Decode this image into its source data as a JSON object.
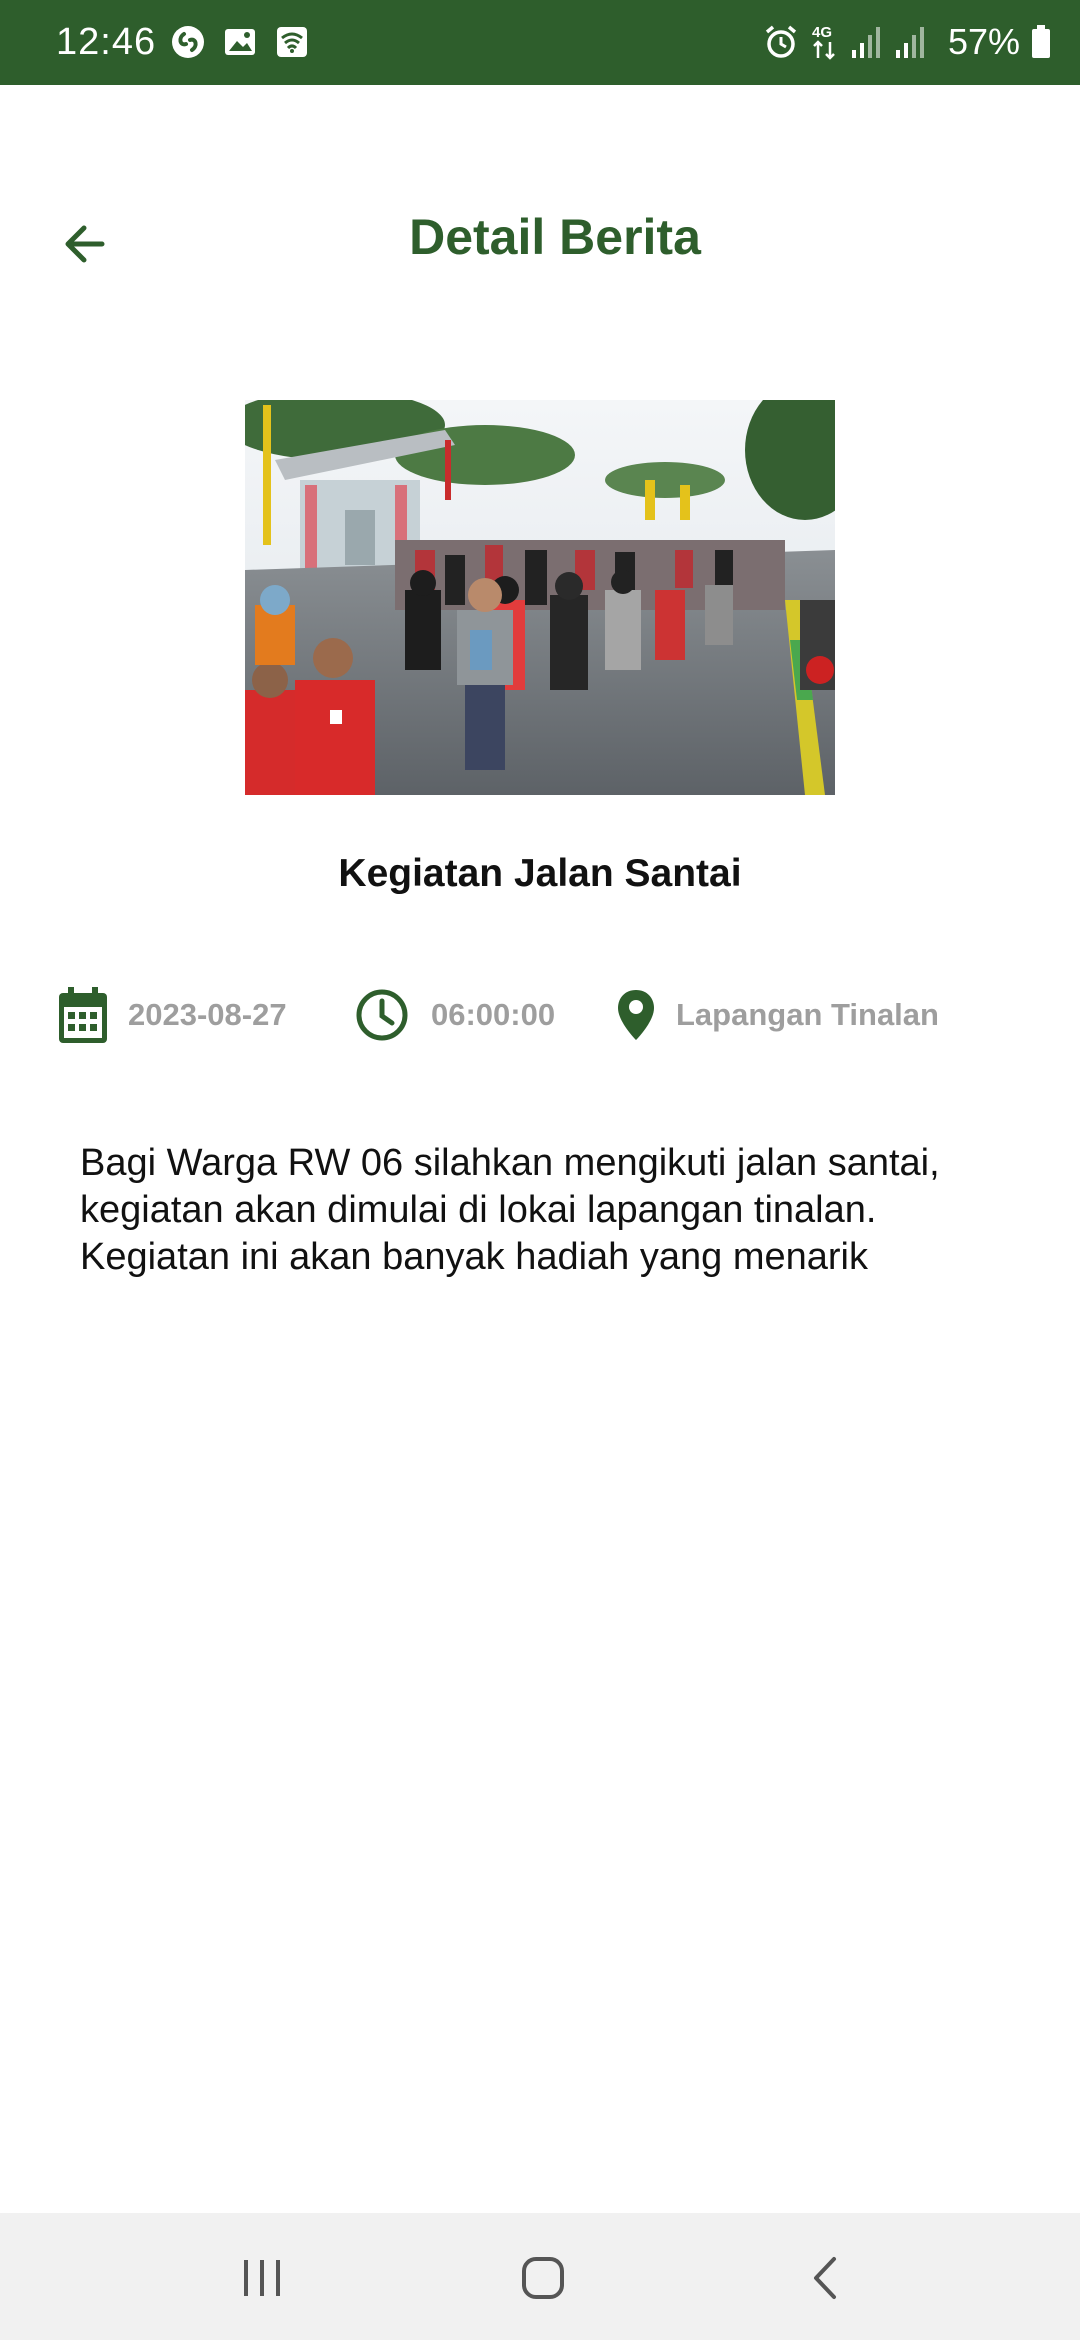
{
  "status_bar": {
    "time": "12:46",
    "battery_percent": "57%",
    "network": "4G",
    "background_color": "#2e5e2c",
    "icons_left": [
      "shazam-icon",
      "gallery-icon",
      "wifi-icon"
    ],
    "icons_right": [
      "alarm-icon",
      "data-4g-icon",
      "signal-icon",
      "signal-icon",
      "battery-icon"
    ]
  },
  "header": {
    "title": "Detail Berita",
    "back_icon": "arrow-left-icon",
    "accent_color": "#2e5e2c"
  },
  "news": {
    "title": "Kegiatan Jalan Santai",
    "date": "2023-08-27",
    "time": "06:00:00",
    "location": "Lapangan Tinalan",
    "body": "Bagi Warga RW 06 silahkan mengikuti jalan santai, kegiatan akan dimulai di lokai lapangan tinalan. Kegiatan ini akan banyak hadiah yang menarik"
  },
  "meta_icons": {
    "date": "calendar-icon",
    "time": "clock-icon",
    "location": "map-pin-icon",
    "text_color": "#9e9e9e"
  },
  "nav_bar": {
    "buttons": [
      "recents-icon",
      "home-icon",
      "back-icon"
    ]
  }
}
